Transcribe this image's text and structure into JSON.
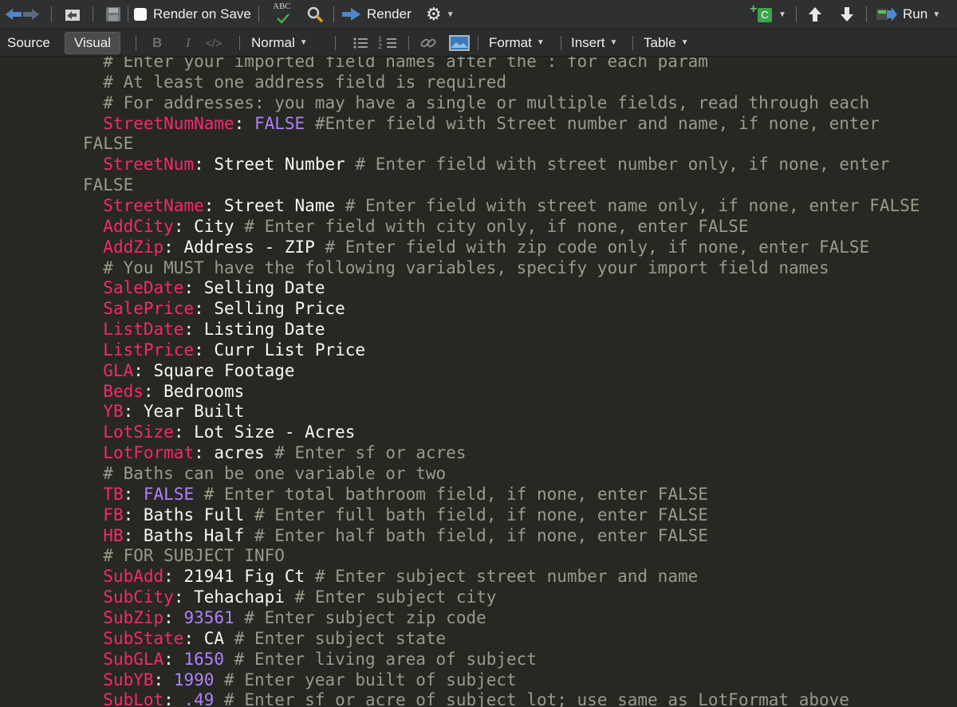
{
  "toolbar": {
    "render_on_save_label": "Render on Save",
    "spellcheck_abc": "ABC",
    "render_label": "Render",
    "chunk_label": "C",
    "run_label": "Run"
  },
  "mode_toolbar": {
    "source_tab": "Source",
    "visual_tab": "Visual",
    "bold_label": "B",
    "italic_label": "I",
    "code_label": "</>",
    "paragraph_style": "Normal",
    "numbered_list_label": "1 2",
    "format_menu": "Format",
    "insert_menu": "Insert",
    "table_menu": "Table"
  },
  "editor": {
    "lines": [
      {
        "indent": "  ",
        "segs": [
          {
            "t": "c",
            "x": "# Enter your imported field names after the : for each param"
          }
        ]
      },
      {
        "indent": "  ",
        "segs": [
          {
            "t": "c",
            "x": "# At least one address field is required"
          }
        ]
      },
      {
        "indent": "  ",
        "segs": [
          {
            "t": "c",
            "x": "# For addresses: you may have a single or multiple fields, read through each"
          }
        ]
      },
      {
        "indent": "  ",
        "segs": [
          {
            "t": "k",
            "x": "StreetNumName"
          },
          {
            "t": "p",
            "x": ": "
          },
          {
            "t": "n",
            "x": "FALSE"
          },
          {
            "t": "c",
            "x": " #Enter field with Street number and name, if none, enter"
          }
        ]
      },
      {
        "indent": "",
        "segs": [
          {
            "t": "c",
            "x": "FALSE"
          }
        ]
      },
      {
        "indent": "  ",
        "segs": [
          {
            "t": "k",
            "x": "StreetNum"
          },
          {
            "t": "p",
            "x": ": "
          },
          {
            "t": "v",
            "x": "Street Number"
          },
          {
            "t": "c",
            "x": " # Enter field with street number only, if none, enter"
          }
        ]
      },
      {
        "indent": "",
        "segs": [
          {
            "t": "c",
            "x": "FALSE"
          }
        ]
      },
      {
        "indent": "  ",
        "segs": [
          {
            "t": "k",
            "x": "StreetName"
          },
          {
            "t": "p",
            "x": ": "
          },
          {
            "t": "v",
            "x": "Street Name"
          },
          {
            "t": "c",
            "x": " # Enter field with street name only, if none, enter FALSE"
          }
        ]
      },
      {
        "indent": "  ",
        "segs": [
          {
            "t": "k",
            "x": "AddCity"
          },
          {
            "t": "p",
            "x": ": "
          },
          {
            "t": "v",
            "x": "City"
          },
          {
            "t": "c",
            "x": " # Enter field with city only, if none, enter FALSE"
          }
        ]
      },
      {
        "indent": "  ",
        "segs": [
          {
            "t": "k",
            "x": "AddZip"
          },
          {
            "t": "p",
            "x": ": "
          },
          {
            "t": "v",
            "x": "Address - ZIP"
          },
          {
            "t": "c",
            "x": " # Enter field with zip code only, if none, enter FALSE"
          }
        ]
      },
      {
        "indent": "  ",
        "segs": [
          {
            "t": "c",
            "x": "# You MUST have the following variables, specify your import field names"
          }
        ]
      },
      {
        "indent": "  ",
        "segs": [
          {
            "t": "k",
            "x": "SaleDate"
          },
          {
            "t": "p",
            "x": ": "
          },
          {
            "t": "v",
            "x": "Selling Date"
          }
        ]
      },
      {
        "indent": "  ",
        "segs": [
          {
            "t": "k",
            "x": "SalePrice"
          },
          {
            "t": "p",
            "x": ": "
          },
          {
            "t": "v",
            "x": "Selling Price"
          }
        ]
      },
      {
        "indent": "  ",
        "segs": [
          {
            "t": "k",
            "x": "ListDate"
          },
          {
            "t": "p",
            "x": ": "
          },
          {
            "t": "v",
            "x": "Listing Date"
          }
        ]
      },
      {
        "indent": "  ",
        "segs": [
          {
            "t": "k",
            "x": "ListPrice"
          },
          {
            "t": "p",
            "x": ": "
          },
          {
            "t": "v",
            "x": "Curr List Price"
          }
        ]
      },
      {
        "indent": "  ",
        "segs": [
          {
            "t": "k",
            "x": "GLA"
          },
          {
            "t": "p",
            "x": ": "
          },
          {
            "t": "v",
            "x": "Square Footage"
          }
        ]
      },
      {
        "indent": "  ",
        "segs": [
          {
            "t": "k",
            "x": "Beds"
          },
          {
            "t": "p",
            "x": ": "
          },
          {
            "t": "v",
            "x": "Bedrooms"
          }
        ]
      },
      {
        "indent": "  ",
        "segs": [
          {
            "t": "k",
            "x": "YB"
          },
          {
            "t": "p",
            "x": ": "
          },
          {
            "t": "v",
            "x": "Year Built"
          }
        ]
      },
      {
        "indent": "  ",
        "segs": [
          {
            "t": "k",
            "x": "LotSize"
          },
          {
            "t": "p",
            "x": ": "
          },
          {
            "t": "v",
            "x": "Lot Size - Acres"
          }
        ]
      },
      {
        "indent": "  ",
        "segs": [
          {
            "t": "k",
            "x": "LotFormat"
          },
          {
            "t": "p",
            "x": ": "
          },
          {
            "t": "v",
            "x": "acres"
          },
          {
            "t": "c",
            "x": " # Enter sf or acres"
          }
        ]
      },
      {
        "indent": "  ",
        "segs": [
          {
            "t": "c",
            "x": "# Baths can be one variable or two"
          }
        ]
      },
      {
        "indent": "  ",
        "segs": [
          {
            "t": "k",
            "x": "TB"
          },
          {
            "t": "p",
            "x": ": "
          },
          {
            "t": "n",
            "x": "FALSE"
          },
          {
            "t": "c",
            "x": " # Enter total bathroom field, if none, enter FALSE"
          }
        ]
      },
      {
        "indent": "  ",
        "segs": [
          {
            "t": "k",
            "x": "FB"
          },
          {
            "t": "p",
            "x": ": "
          },
          {
            "t": "v",
            "x": "Baths Full"
          },
          {
            "t": "c",
            "x": " # Enter full bath field, if none, enter FALSE"
          }
        ]
      },
      {
        "indent": "  ",
        "segs": [
          {
            "t": "k",
            "x": "HB"
          },
          {
            "t": "p",
            "x": ": "
          },
          {
            "t": "v",
            "x": "Baths Half"
          },
          {
            "t": "c",
            "x": " # Enter half bath field, if none, enter FALSE"
          }
        ]
      },
      {
        "indent": "  ",
        "segs": [
          {
            "t": "c",
            "x": "# FOR SUBJECT INFO"
          }
        ]
      },
      {
        "indent": "  ",
        "segs": [
          {
            "t": "k",
            "x": "SubAdd"
          },
          {
            "t": "p",
            "x": ": "
          },
          {
            "t": "v",
            "x": "21941 Fig Ct"
          },
          {
            "t": "c",
            "x": " # Enter subject street number and name"
          }
        ]
      },
      {
        "indent": "  ",
        "segs": [
          {
            "t": "k",
            "x": "SubCity"
          },
          {
            "t": "p",
            "x": ": "
          },
          {
            "t": "v",
            "x": "Tehachapi"
          },
          {
            "t": "c",
            "x": " # Enter subject city"
          }
        ]
      },
      {
        "indent": "  ",
        "segs": [
          {
            "t": "k",
            "x": "SubZip"
          },
          {
            "t": "p",
            "x": ": "
          },
          {
            "t": "n",
            "x": "93561"
          },
          {
            "t": "c",
            "x": " # Enter subject zip code"
          }
        ]
      },
      {
        "indent": "  ",
        "segs": [
          {
            "t": "k",
            "x": "SubState"
          },
          {
            "t": "p",
            "x": ": "
          },
          {
            "t": "v",
            "x": "CA"
          },
          {
            "t": "c",
            "x": " # Enter subject state"
          }
        ]
      },
      {
        "indent": "  ",
        "segs": [
          {
            "t": "k",
            "x": "SubGLA"
          },
          {
            "t": "p",
            "x": ": "
          },
          {
            "t": "n",
            "x": "1650"
          },
          {
            "t": "c",
            "x": " # Enter living area of subject"
          }
        ]
      },
      {
        "indent": "  ",
        "segs": [
          {
            "t": "k",
            "x": "SubYB"
          },
          {
            "t": "p",
            "x": ": "
          },
          {
            "t": "n",
            "x": "1990"
          },
          {
            "t": "c",
            "x": " # Enter year built of subject"
          }
        ]
      },
      {
        "indent": "  ",
        "segs": [
          {
            "t": "k",
            "x": "SubLot"
          },
          {
            "t": "p",
            "x": ": "
          },
          {
            "t": "n",
            "x": ".49"
          },
          {
            "t": "c",
            "x": " # Enter sf or acre of subject lot; use same as LotFormat above"
          }
        ]
      }
    ]
  },
  "colors": {
    "background": "#272822",
    "key": "#f92672",
    "comment": "#9a9a8a",
    "value": "#f8f8f2",
    "constant": "#ae81ff",
    "toolbar": "#2f3030"
  },
  "icons": [
    "back-arrow-icon",
    "forward-arrow-icon",
    "goto-dir-icon",
    "save-icon",
    "spellcheck-icon",
    "find-icon",
    "render-icon",
    "gear-icon",
    "insert-chunk-icon",
    "up-arrow-icon",
    "down-arrow-icon",
    "run-icon",
    "bullet-list-icon",
    "numbered-list-icon",
    "link-icon",
    "image-icon"
  ]
}
